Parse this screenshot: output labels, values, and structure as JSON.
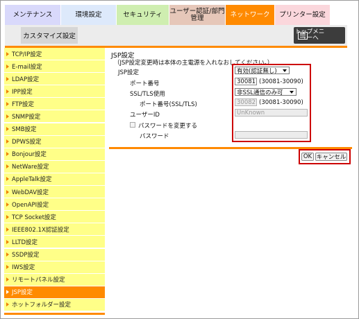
{
  "tabs": {
    "maintenance": "メンテナンス",
    "environment": "環境設定",
    "security": "セキュリティ",
    "user_auth": "ユーザー認証/部門管理",
    "network": "ネットワーク",
    "printer": "プリンター設定"
  },
  "subtab": {
    "customize": "カスタマイズ設定"
  },
  "top_menu": {
    "label": "トップメニューへ",
    "icon": "menu-list-icon"
  },
  "sidebar": {
    "items": [
      {
        "label": "TCP/IP設定"
      },
      {
        "label": "E-mail設定"
      },
      {
        "label": "LDAP設定"
      },
      {
        "label": "IPP設定"
      },
      {
        "label": "FTP設定"
      },
      {
        "label": "SNMP設定"
      },
      {
        "label": "SMB設定"
      },
      {
        "label": "DPWS設定"
      },
      {
        "label": "Bonjour設定"
      },
      {
        "label": "NetWare設定"
      },
      {
        "label": "AppleTalk設定"
      },
      {
        "label": "WebDAV設定"
      },
      {
        "label": "OpenAPI設定"
      },
      {
        "label": "TCP Socket設定"
      },
      {
        "label": "IEEE802.1X認証設定"
      },
      {
        "label": "LLTD設定"
      },
      {
        "label": "SSDP設定"
      },
      {
        "label": "IWS設定"
      },
      {
        "label": "リモートパネル設定"
      },
      {
        "label": "JSP設定",
        "active": true
      },
      {
        "label": "ホットフォルダー設定"
      }
    ]
  },
  "main": {
    "title": "JSP設定",
    "note": "（JSP設定変更時は本体の主電源を入れなおしてください。）",
    "jsp": {
      "label": "JSP設定",
      "value": "有効(認証無し)"
    },
    "port": {
      "label": "ポート番号",
      "value": "30081",
      "range": "(30081-30090)"
    },
    "ssl": {
      "label": "SSL/TLS使用",
      "value": "非SSL通信のみ可"
    },
    "ssl_port": {
      "label": "ポート番号(SSL/TLS)",
      "value": "30082",
      "range": "(30081-30090)"
    },
    "user_id": {
      "label": "ユーザーID",
      "value": "UnKnown"
    },
    "change_password": {
      "label": "パスワードを変更する",
      "checked": false
    },
    "password": {
      "label": "パスワード",
      "value": ""
    }
  },
  "buttons": {
    "ok": "OK",
    "cancel": "キャンセル"
  },
  "colors": {
    "accent": "#ff8a00",
    "highlight": "#cc0000",
    "sidebar_bg": "#ffff88"
  }
}
